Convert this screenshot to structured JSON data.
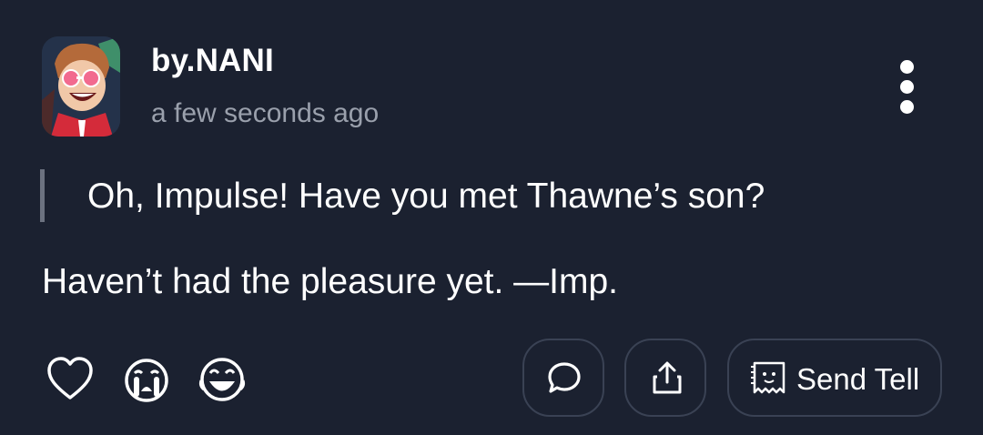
{
  "post": {
    "author": "by.NANI",
    "timestamp": "a few seconds ago",
    "quote": "Oh, Impulse! Have you met Thawne’s son?",
    "reply": "Haven’t had the pleasure yet. —Imp."
  },
  "actions": {
    "reactions": [
      "heart-icon",
      "crying-face-icon",
      "laughing-face-icon"
    ],
    "comment_icon": "comment-icon",
    "share_icon": "share-icon",
    "send_tell_label": "Send Tell",
    "send_tell_icon": "ghost-note-icon"
  },
  "colors": {
    "background": "#1b2130",
    "text": "#ffffff",
    "muted": "#9aa0ac",
    "border": "#3a4254",
    "quote_bar": "#6c7280"
  }
}
